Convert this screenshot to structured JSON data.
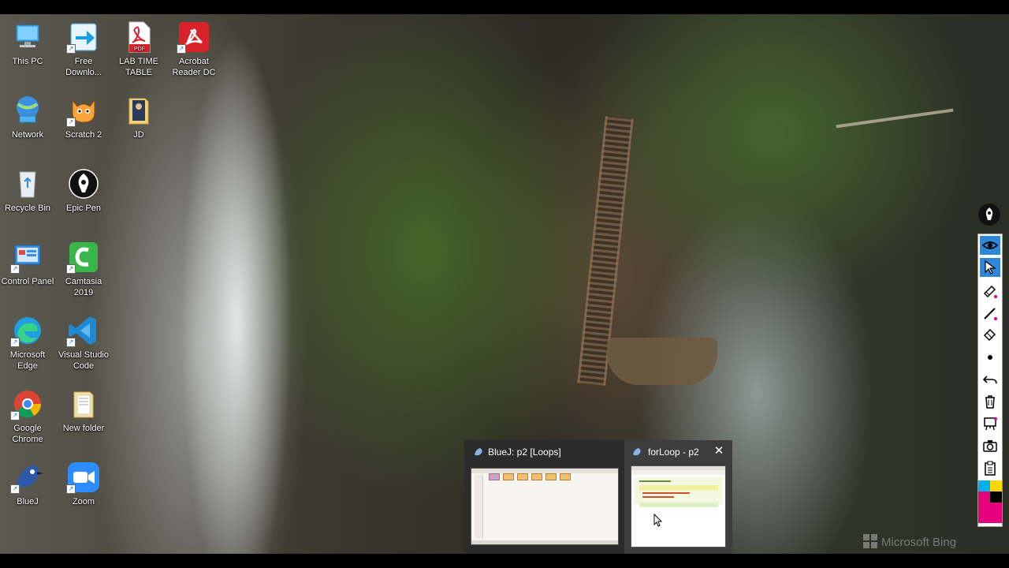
{
  "desktop": {
    "icons": [
      {
        "label": "This PC",
        "icon": "this-pc-icon"
      },
      {
        "label": "Free Downlo...",
        "icon": "download-app-icon"
      },
      {
        "label": "LAB TIME TABLE",
        "icon": "pdf-file-icon"
      },
      {
        "label": "Acrobat Reader DC",
        "icon": "acrobat-icon"
      },
      {
        "label": "Network",
        "icon": "network-icon"
      },
      {
        "label": "Scratch 2",
        "icon": "scratch-icon"
      },
      {
        "label": "JD",
        "icon": "folder-icon"
      },
      {
        "label": "Recycle Bin",
        "icon": "recycle-bin-icon"
      },
      {
        "label": "Epic Pen",
        "icon": "epic-pen-icon"
      },
      {
        "label": "Control Panel",
        "icon": "control-panel-icon"
      },
      {
        "label": "Camtasia 2019",
        "icon": "camtasia-icon"
      },
      {
        "label": "Microsoft Edge",
        "icon": "edge-icon"
      },
      {
        "label": "Visual Studio Code",
        "icon": "vscode-icon"
      },
      {
        "label": "Google Chrome",
        "icon": "chrome-icon"
      },
      {
        "label": "New folder",
        "icon": "folder-icon"
      },
      {
        "label": "BlueJ",
        "icon": "bluej-icon"
      },
      {
        "label": "Zoom",
        "icon": "zoom-icon"
      }
    ]
  },
  "taskbar_preview": {
    "windows": [
      {
        "title": "BlueJ:  p2  [Loops]",
        "icon": "bluej-icon"
      },
      {
        "title": "forLoop - p2",
        "icon": "bluej-icon",
        "close_icon": "close-icon"
      }
    ]
  },
  "wallpaper": {
    "brand": "Microsoft Bing"
  },
  "epic_pen_toolbar": {
    "tools": [
      "eye-icon",
      "cursor-icon",
      "pen-icon",
      "line-icon",
      "highlighter-icon",
      "brush-size-icon",
      "undo-icon",
      "trash-icon",
      "whiteboard-icon",
      "camera-icon",
      "clipboard-icon",
      "color-palette-icon"
    ],
    "active_tools": [
      "eye-icon",
      "cursor-icon"
    ],
    "colors": [
      "#00b0f0",
      "#ffd800",
      "#e6007e",
      "#000000",
      "#e6007e"
    ]
  }
}
